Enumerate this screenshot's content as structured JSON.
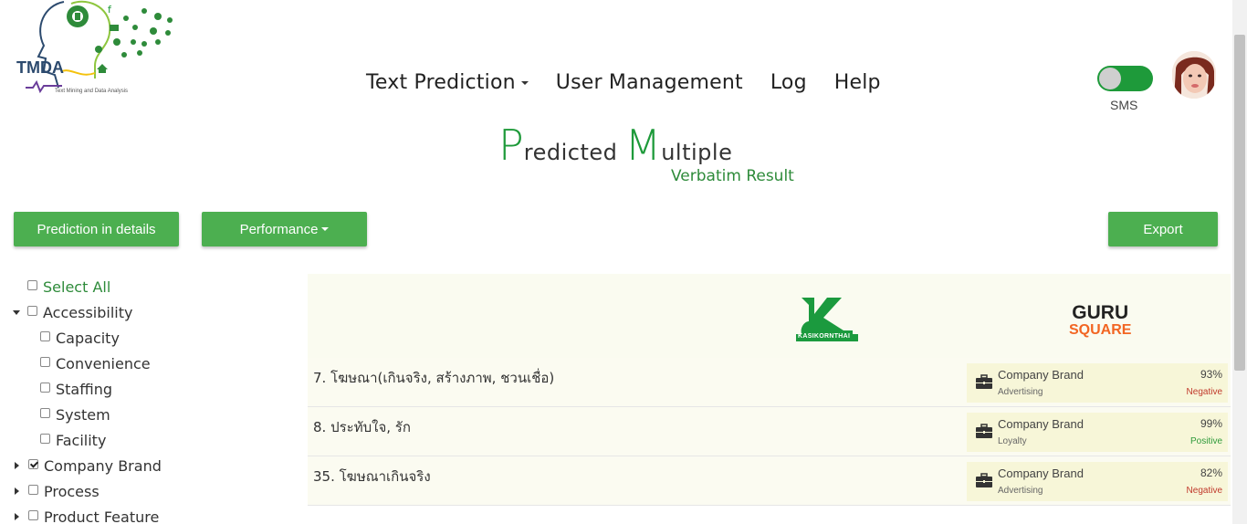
{
  "logo": {
    "text": "TMDA",
    "subtitle": "Text Mining and Data Analysis"
  },
  "nav": {
    "text_prediction": "Text Prediction",
    "user_management": "User Management",
    "log": "Log",
    "help": "Help"
  },
  "toggle": {
    "label": "SMS",
    "on": true
  },
  "title": {
    "p": "P",
    "p_rest": "redicted",
    "m": "M",
    "m_rest": "ultiple",
    "sub": "Verbatim Result"
  },
  "buttons": {
    "prediction_details": "Prediction in details",
    "performance": "Performance",
    "export": "Export"
  },
  "tree": {
    "select_all": "Select All",
    "accessibility": "Accessibility",
    "capacity": "Capacity",
    "convenience": "Convenience",
    "staffing": "Staffing",
    "system": "System",
    "facility": "Facility",
    "company_brand": "Company Brand",
    "process": "Process",
    "product_feature": "Product Feature"
  },
  "brands": {
    "left": "KASIKORNTHAI",
    "right_top": "GURU",
    "right_bottom": "SQUARE"
  },
  "rows": [
    {
      "text": "7. โฆษณา(เกินจริง, สร้างภาพ, ชวนเชื่อ)",
      "category": "Company Brand",
      "sub": "Advertising",
      "pct": "93%",
      "sentiment": "Negative"
    },
    {
      "text": "8. ประทับใจ, รัก",
      "category": "Company Brand",
      "sub": "Loyalty",
      "pct": "99%",
      "sentiment": "Positive"
    },
    {
      "text": "35. โฆษณาเกินจริง",
      "category": "Company Brand",
      "sub": "Advertising",
      "pct": "82%",
      "sentiment": "Negative"
    }
  ],
  "colors": {
    "accent": "#4caf50",
    "negative": "#c0392b",
    "positive": "#2e9a3a"
  }
}
